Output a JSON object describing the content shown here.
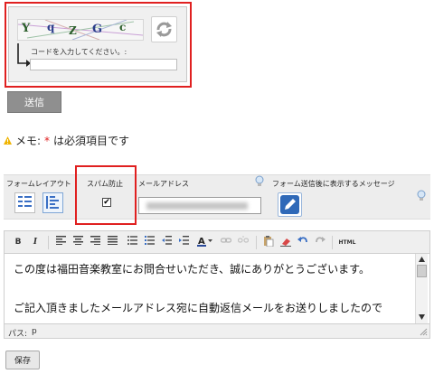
{
  "captcha": {
    "characters": [
      "Y",
      "q",
      "Z",
      "G",
      "c"
    ],
    "code_label": "コードを入力してください。:",
    "code_value": ""
  },
  "form": {
    "submit_label": "送信",
    "memo_prefix": "メモ:",
    "memo_asterisk": "*",
    "memo_text": "は必須項目です"
  },
  "settings": {
    "layout_label": "フォームレイアウト",
    "spam_label": "スパム防止",
    "spam_checked": true,
    "email_label": "メールアドレス",
    "email_value": "",
    "message_label": "フォーム送信後に表示するメッセージ"
  },
  "editor": {
    "toolbar": {
      "bold": "B",
      "italic": "I",
      "html": "HTML"
    },
    "content_lines": [
      "この度は福田音楽教室にお問合せいただき、誠にありがとうございます。",
      "",
      "ご記入頂きましたメールアドレス宛に自動返信メールをお送りしましたので"
    ],
    "path_label": "パス:",
    "path_value": "p"
  },
  "save_label": "保存",
  "colors": {
    "highlight": "#e02020",
    "accent": "#3a6fc4"
  }
}
